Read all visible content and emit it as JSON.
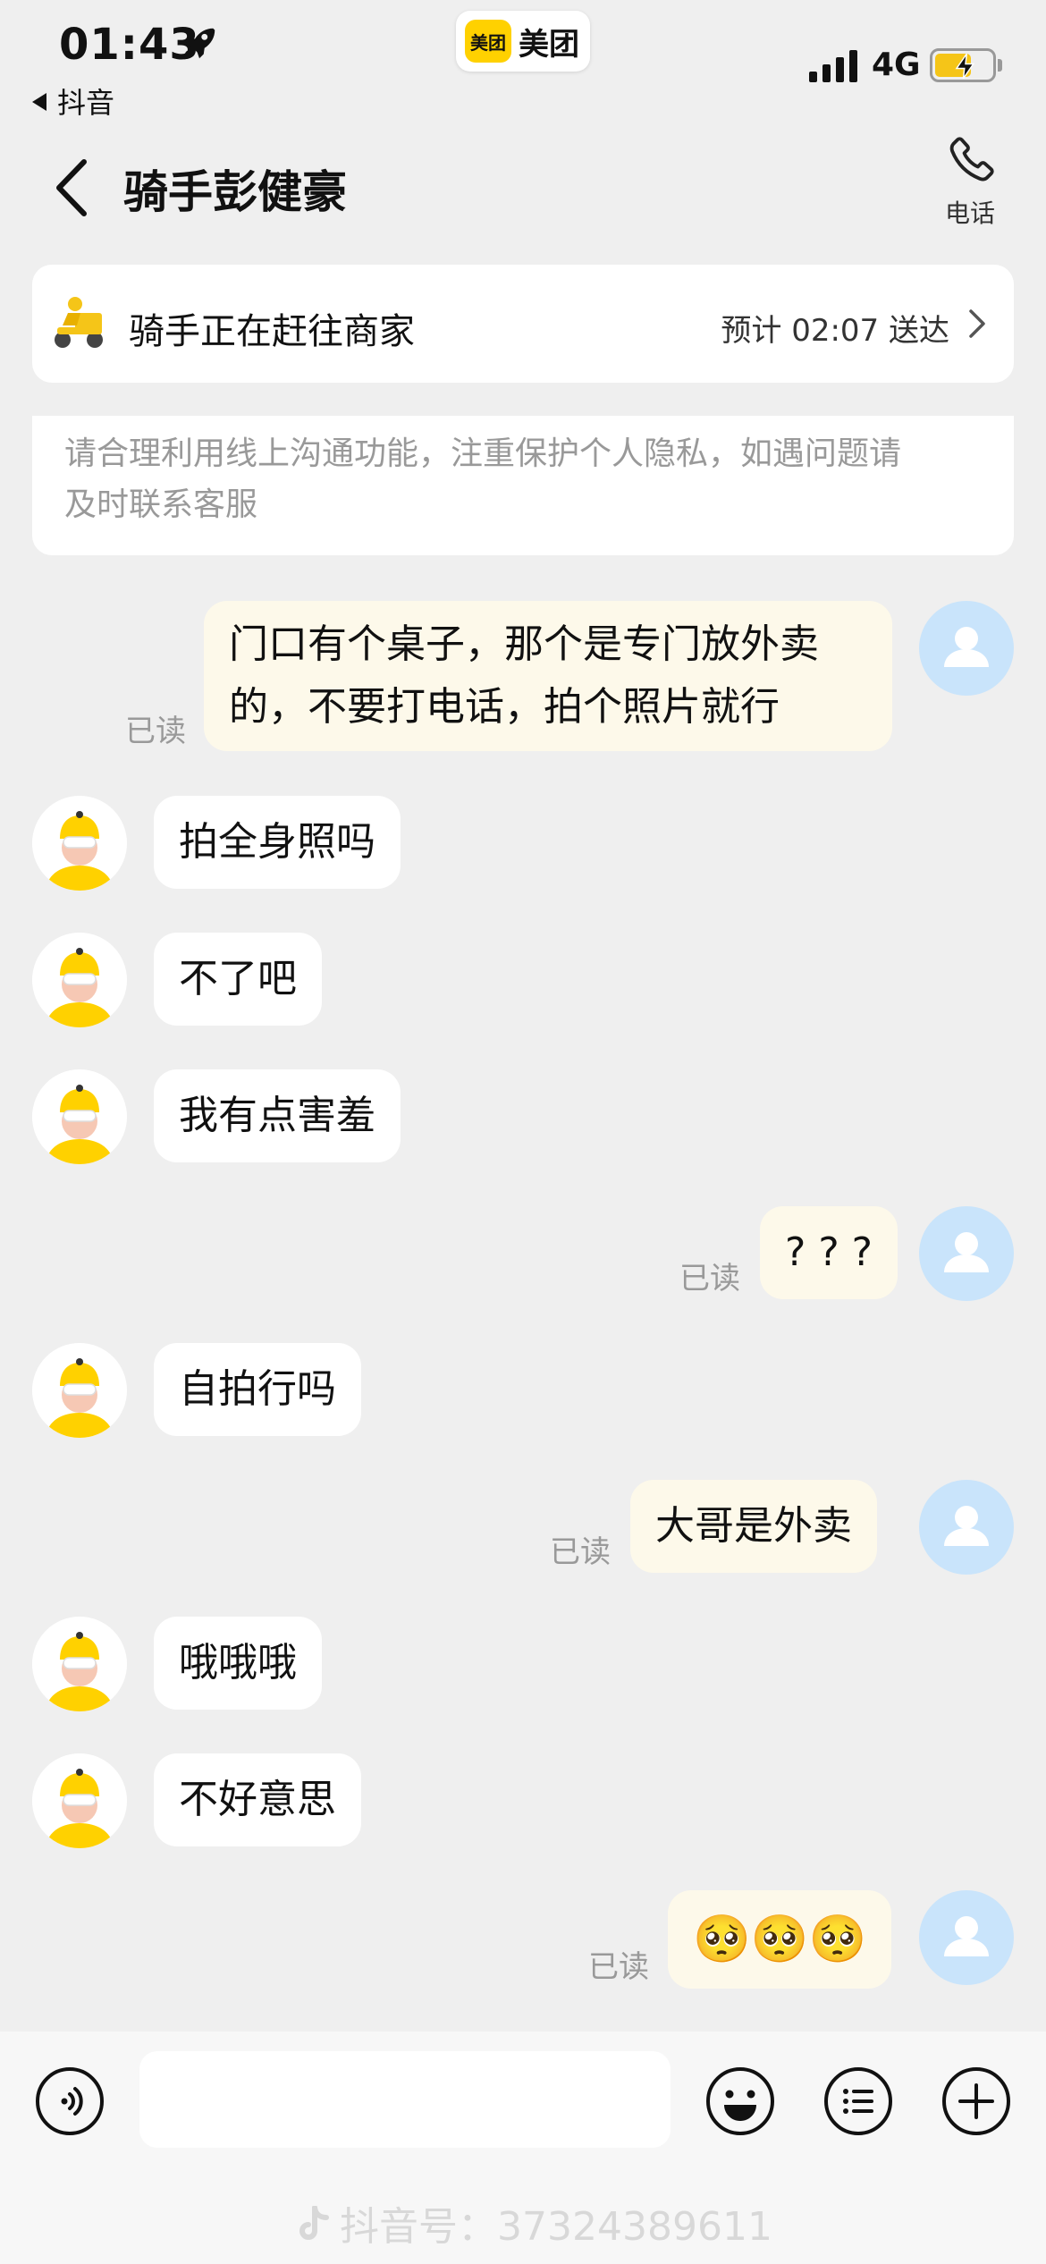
{
  "status_bar": {
    "time": "01:43",
    "back_app": "抖音",
    "center_app_logo": "美团",
    "center_app_name": "美团",
    "network": "4G"
  },
  "header": {
    "title": "骑手彭健豪",
    "phone_label": "电话"
  },
  "status_card": {
    "message": "骑手正在赶往商家",
    "eta": "预计 02:07 送达"
  },
  "notice": {
    "line1": "请合理利用线上沟通功能，注重保护个人隐私，如遇问题请",
    "line2": "及时联系客服"
  },
  "messages": [
    {
      "from": "me",
      "lines": [
        "门口有个桌子，那个是专门放外卖",
        "的，不要打电话，拍个照片就行"
      ],
      "status": "已读"
    },
    {
      "from": "rider",
      "text": "拍全身照吗"
    },
    {
      "from": "rider",
      "text": "不了吧"
    },
    {
      "from": "rider",
      "text": "我有点害羞"
    },
    {
      "from": "me",
      "text": "? ? ?",
      "status": "已读"
    },
    {
      "from": "rider",
      "text": "自拍行吗"
    },
    {
      "from": "me",
      "text": "大哥是外卖",
      "status": "已读"
    },
    {
      "from": "rider",
      "text": "哦哦哦"
    },
    {
      "from": "rider",
      "text": "不好意思"
    },
    {
      "from": "me",
      "text": "🥺🥺🥺",
      "status": "已读"
    }
  ],
  "input": {
    "placeholder": ""
  },
  "watermark": "抖音号：37324389611",
  "colors": {
    "background": "#efefef",
    "outgoing_bubble": "#fdf9ea",
    "incoming_bubble": "#ffffff",
    "my_avatar": "#c9e4fb",
    "brand_yellow": "#ffd100"
  }
}
